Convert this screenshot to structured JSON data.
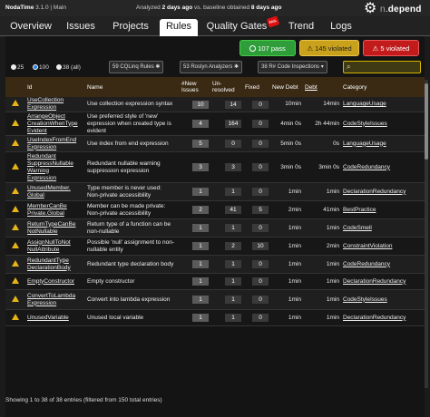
{
  "topbar": {
    "app_name": "NodaTime",
    "app_version": "3.1.0",
    "branch": "Main",
    "analyzed_prefix": "Analyzed",
    "analyzed_when": "2 days ago",
    "baseline_prefix": "vs. baseline obtained",
    "baseline_when": "8 days ago",
    "logo_text": "n",
    "logo_text2": "depend"
  },
  "tabs": [
    {
      "label": "Overview"
    },
    {
      "label": "Issues"
    },
    {
      "label": "Projects"
    },
    {
      "label": "Rules"
    },
    {
      "label": "Quality Gates",
      "badge": "FAIL"
    },
    {
      "label": "Trend"
    },
    {
      "label": "Logs"
    }
  ],
  "status": {
    "pass": "107 pass",
    "violated_warn": "145 violated",
    "violated_err": "5 violated"
  },
  "filters": {
    "radio25": "25",
    "radio100": "100",
    "radio38": "38 (all)",
    "cqlinq": "59 CQLinq Rules",
    "roslyn": "53 Roslyn Analyzers",
    "r_code": "38 R# Code Inspections",
    "search_placeholder": ""
  },
  "table": {
    "headers": [
      "Id",
      "Name",
      "#New Issues",
      "Un-resolved",
      "Fixed",
      "New Debt",
      "Debt",
      "Category"
    ],
    "rows": [
      {
        "id": [
          "UseCollection",
          "Expression"
        ],
        "name": [
          "Use collection expression syntax"
        ],
        "new": "10",
        "unres": "14",
        "fixed": "0",
        "ndebt": "10min",
        "debt": "14min",
        "cat": "LanguageUsage"
      },
      {
        "id": [
          "ArrangeObject",
          "CreationWhenType",
          "Evident"
        ],
        "name": [
          "Use preferred style of 'new'",
          "expression when created type is",
          "evident"
        ],
        "new": "4",
        "unres": "164",
        "fixed": "0",
        "ndebt": "4min 0s",
        "debt": "2h 44min",
        "cat": "CodeStyleIssues"
      },
      {
        "id": [
          "UseIndexFromEnd",
          "Expression"
        ],
        "name": [
          "Use index from end expression"
        ],
        "new": "5",
        "unres": "0",
        "fixed": "0",
        "ndebt": "5min 0s",
        "debt": "0s",
        "cat": "LanguageUsage"
      },
      {
        "id": [
          "Redundant",
          "SuppressNullable",
          "Warning",
          "Expression"
        ],
        "name": [
          "Redundant nullable warning",
          "suppression expression"
        ],
        "new": "3",
        "unres": "3",
        "fixed": "0",
        "ndebt": "3min 0s",
        "debt": "3min 0s",
        "cat": "CodeRedundancy"
      },
      {
        "id": [
          "UnusedMember.",
          "Global"
        ],
        "name": [
          "Type member is never used:",
          "Non-private accessibility"
        ],
        "new": "1",
        "unres": "1",
        "fixed": "0",
        "ndebt": "1min",
        "debt": "1min",
        "cat": "DeclarationRedundancy"
      },
      {
        "id": [
          "MemberCanBe",
          "Private.Global"
        ],
        "name": [
          "Member can be made private:",
          "Non-private accessibility"
        ],
        "new": "2",
        "unres": "41",
        "fixed": "5",
        "ndebt": "2min",
        "debt": "41min",
        "cat": "BestPractice"
      },
      {
        "id": [
          "ReturnTypeCanBe",
          "NotNullable"
        ],
        "name": [
          "Return type of a function can be",
          "non-nullable"
        ],
        "new": "1",
        "unres": "1",
        "fixed": "0",
        "ndebt": "1min",
        "debt": "1min",
        "cat": "CodeSmell"
      },
      {
        "id": [
          "AssignNullToNot",
          "NullAttribute"
        ],
        "name": [
          "Possible 'null' assignment to non-",
          "nullable entity"
        ],
        "new": "1",
        "unres": "2",
        "fixed": "10",
        "ndebt": "1min",
        "debt": "2min",
        "cat": "ConstraintViolation"
      },
      {
        "id": [
          "RedundantType",
          "DeclarationBody"
        ],
        "name": [
          "Redundant type declaration body"
        ],
        "new": "1",
        "unres": "1",
        "fixed": "0",
        "ndebt": "1min",
        "debt": "1min",
        "cat": "CodeRedundancy"
      },
      {
        "id": [
          "EmptyConstructor"
        ],
        "name": [
          "Empty constructor"
        ],
        "new": "1",
        "unres": "1",
        "fixed": "0",
        "ndebt": "1min",
        "debt": "1min",
        "cat": "DeclarationRedundancy"
      },
      {
        "id": [
          "ConvertToLambda",
          "Expression"
        ],
        "name": [
          "Convert into lambda expression"
        ],
        "new": "1",
        "unres": "1",
        "fixed": "0",
        "ndebt": "1min",
        "debt": "1min",
        "cat": "CodeStyleIssues"
      },
      {
        "id": [
          "UnusedVariable"
        ],
        "name": [
          "Unused local variable"
        ],
        "new": "1",
        "unres": "1",
        "fixed": "0",
        "ndebt": "1min",
        "debt": "1min",
        "cat": "DeclarationRedundancy"
      }
    ]
  },
  "footer": "Showing 1 to 38 of 38 entries (filtered from 150 total entries)",
  "colors": {
    "pass": "#2f9e3a",
    "warn": "#c9a11a",
    "error": "#c11b1b",
    "header_bg": "#3a2a14"
  }
}
